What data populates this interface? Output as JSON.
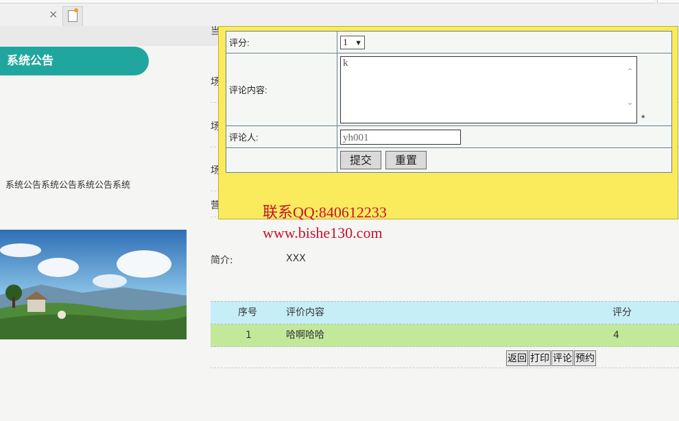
{
  "browser": {
    "tab_close_glyph": "×",
    "new_tab_icon": "new-tab-document-icon"
  },
  "sidebar": {
    "notice_title": "系统公告",
    "notice_text": "系统公告系统公告系统公告系统",
    "accent_color": "#1fa79f"
  },
  "main": {
    "side_chars": [
      "当",
      "场",
      "场",
      "场",
      "营"
    ],
    "intro_label": "简介:",
    "intro_value": "XXX",
    "table": {
      "headers": [
        "序号",
        "评价内容",
        "评分"
      ],
      "rows": [
        {
          "no": "1",
          "content": "哈啊哈哈",
          "score": "4"
        }
      ]
    },
    "buttons": [
      "返回",
      "打印",
      "评论",
      "预约"
    ]
  },
  "popup": {
    "score_label": "评分:",
    "score_value": "1",
    "content_label": "评论内容:",
    "content_value": "k",
    "required_mark": "*",
    "reviewer_label": "评论人:",
    "reviewer_value": "yh001",
    "submit_label": "提交",
    "reset_label": "重置",
    "bg_color": "#faeb5d"
  },
  "watermark": {
    "line1": "联系QQ:840612233",
    "line2": "www.bishe130.com"
  }
}
